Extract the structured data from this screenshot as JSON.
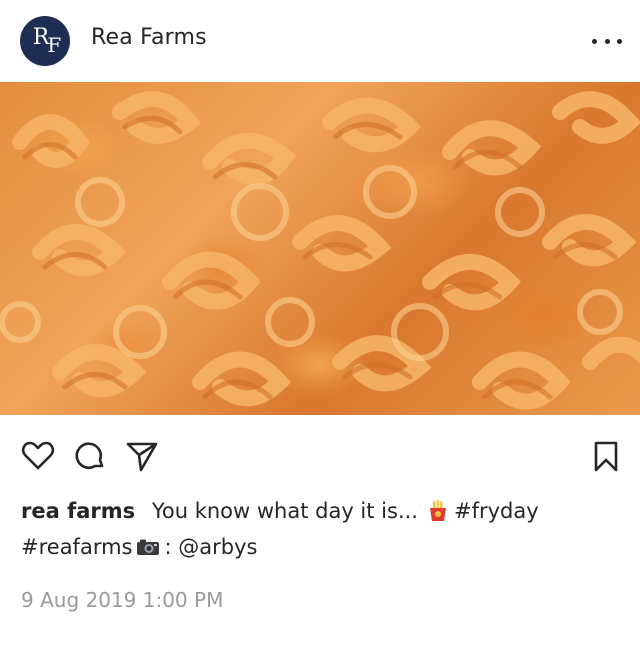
{
  "header": {
    "avatar_initials": "RF",
    "username": "Rea Farms",
    "more_icon": "more-horizontal-icon"
  },
  "media": {
    "alt": "curly fries"
  },
  "actions": {
    "like_icon": "heart-icon",
    "comment_icon": "comment-bubble-icon",
    "share_icon": "send-plane-icon",
    "save_icon": "bookmark-icon"
  },
  "caption": {
    "username": "rea farms",
    "text_part1": "You know what day it is...",
    "hashtag1": "#fryday",
    "hashtag2": "#reafarms",
    "text_part2": ": @arbys"
  },
  "timestamp": "9 Aug 2019 1:00 PM",
  "colors": {
    "avatar_bg": "#1e2d53",
    "text": "#262626",
    "muted": "#9a9a9a"
  }
}
